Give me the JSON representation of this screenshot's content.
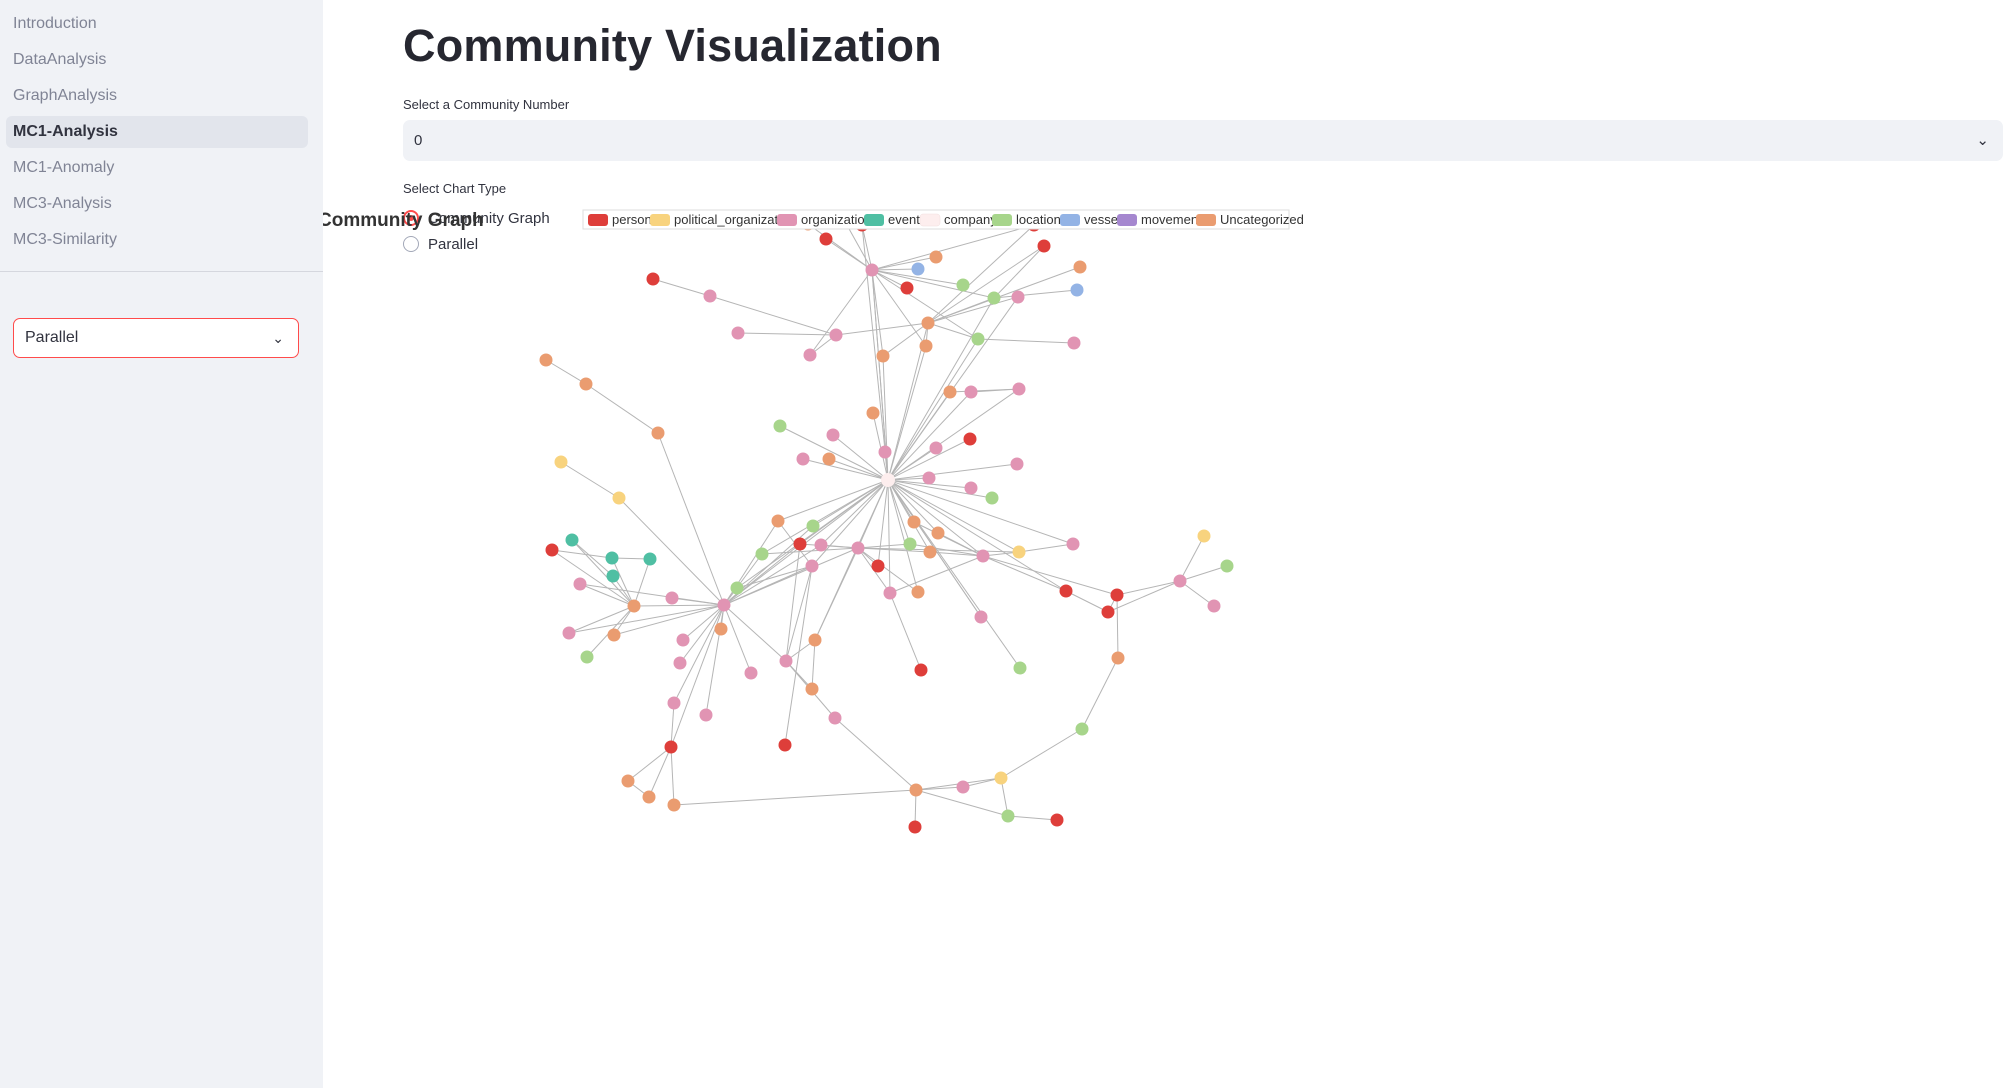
{
  "sidebar": {
    "nav": [
      {
        "label": "Introduction",
        "active": false
      },
      {
        "label": "DataAnalysis",
        "active": false
      },
      {
        "label": "GraphAnalysis",
        "active": false
      },
      {
        "label": "MC1-Analysis",
        "active": true
      },
      {
        "label": "MC1-Anomaly",
        "active": false
      },
      {
        "label": "MC3-Analysis",
        "active": false
      },
      {
        "label": "MC3-Similarity",
        "active": false
      }
    ],
    "select_value": "Parallel"
  },
  "main": {
    "title": "Community Visualization",
    "community_label": "Select a Community Number",
    "community_value": "0",
    "chart_type_label": "Select Chart Type",
    "chart_type_options": [
      "Community Graph",
      "Parallel"
    ],
    "chart_type_selected": "Community Graph"
  },
  "chart": {
    "title": "Community Graph",
    "legend": [
      {
        "label": "person",
        "color": "#de3e3a"
      },
      {
        "label": "political_organization",
        "color": "#f8d37e"
      },
      {
        "label": "organization",
        "color": "#e194b3"
      },
      {
        "label": "event",
        "color": "#4fbfa3"
      },
      {
        "label": "company",
        "color": "#fdeeee"
      },
      {
        "label": "location",
        "color": "#a7d58b"
      },
      {
        "label": "vessel",
        "color": "#93b3e5"
      },
      {
        "label": "movement",
        "color": "#a587cf"
      },
      {
        "label": "Uncategorized",
        "color": "#ea9c70"
      }
    ]
  },
  "colors": {
    "accent": "#ff4b4b",
    "sidebar_bg": "#f0f2f6",
    "edge": "#b5b5b5"
  }
}
